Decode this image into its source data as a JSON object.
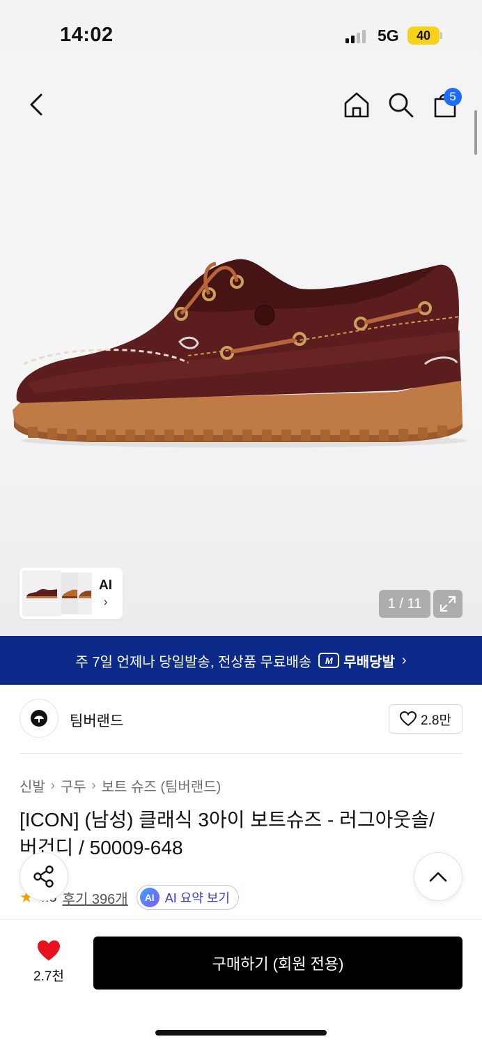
{
  "status_bar": {
    "time": "14:02",
    "network": "5G",
    "battery": "40"
  },
  "nav": {
    "back_icon": "chevron-left-icon",
    "home_icon": "home-icon",
    "search_icon": "search-icon",
    "cart_icon": "shopping-bag-icon",
    "cart_count": "5"
  },
  "gallery": {
    "ai_label": "AI",
    "current_page": "1",
    "total_pages": "11",
    "pager_text": "1 / 11"
  },
  "banner": {
    "text": "주 7일 언제나 당일발송, 전상품 무료배송",
    "brand_badge": "M",
    "brand_text": "무배당발",
    "chevron": "›"
  },
  "brand": {
    "name": "팀버랜드",
    "like_count": "2.8만"
  },
  "breadcrumb": [
    "신발",
    "구두",
    "보트 슈즈 (팀버랜드)"
  ],
  "product": {
    "title": "[ICON] (남성) 클래식 3아이 보트슈즈 - 러그아웃솔/버건디 / 50009-648",
    "rating": "4.8",
    "reviews": "후기 396개",
    "ai_badge": "AI",
    "ai_summary": "AI 요약 보기"
  },
  "bottom": {
    "wish_count": "2.7천",
    "buy_label": "구매하기 (회원 전용)"
  },
  "colors": {
    "banner_bg": "#0b2a8a",
    "cart_badge": "#1e6bff",
    "wish_heart": "#e8121f",
    "battery": "#f7d21b",
    "buy_button": "#000000"
  }
}
